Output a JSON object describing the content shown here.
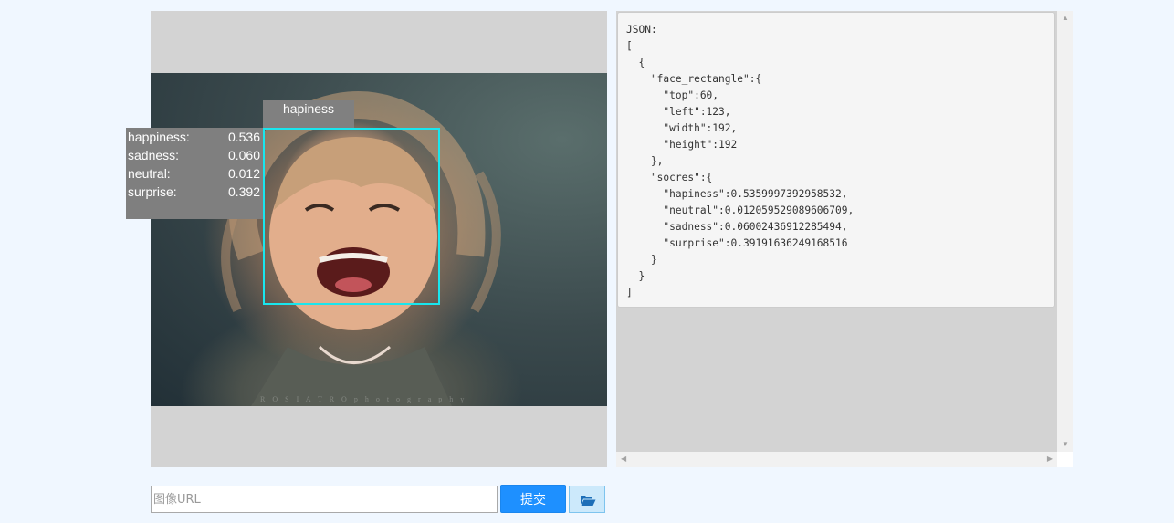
{
  "emotion_label": "hapiness",
  "scores": [
    {
      "label": "happiness:",
      "value": "0.536"
    },
    {
      "label": "sadness:",
      "value": "0.060"
    },
    {
      "label": "neutral:",
      "value": "0.012"
    },
    {
      "label": "surprise:",
      "value": "0.392"
    }
  ],
  "photo_watermark": "R O S I A T R O   p h o t o g r a p h y",
  "json_output": "JSON:\n[\n  {\n    \"face_rectangle\":{\n      \"top\":60,\n      \"left\":123,\n      \"width\":192,\n      \"height\":192\n    },\n    \"socres\":{\n      \"hapiness\":0.5359997392958532,\n      \"neutral\":0.012059529089606709,\n      \"sadness\":0.06002436912285494,\n      \"surprise\":0.39191636249168516\n    }\n  }\n]",
  "url_input": {
    "placeholder": "图像URL",
    "value": ""
  },
  "submit_label": "提交",
  "icons": {
    "upload": "folder-open-icon"
  },
  "colors": {
    "face_box": "#19e6ee",
    "submit": "#1e90ff",
    "label_bg": "#808080"
  }
}
